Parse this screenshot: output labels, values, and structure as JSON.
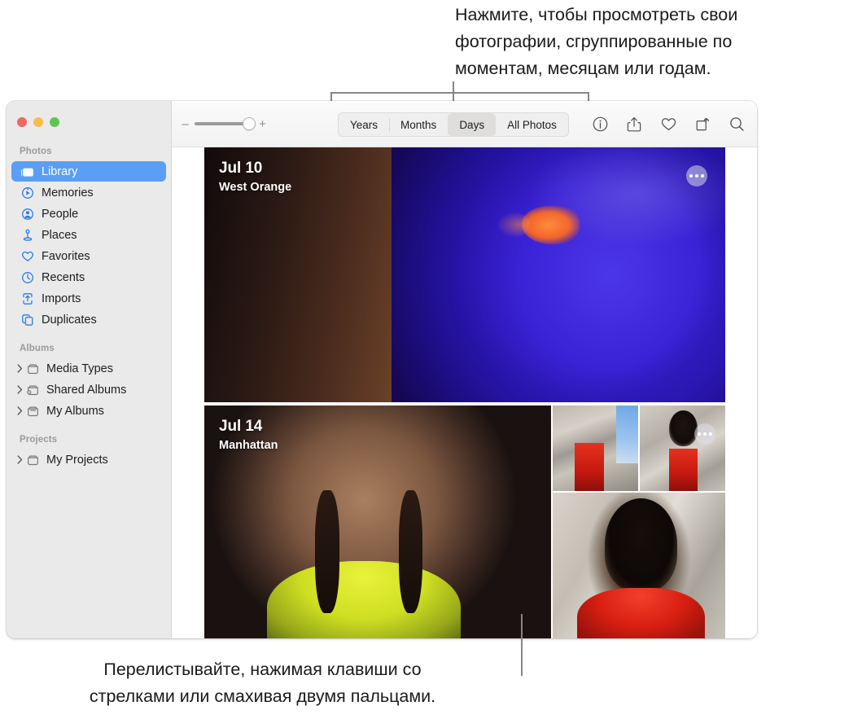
{
  "callouts": {
    "top": "Нажмите, чтобы просмотреть свои\nфотографии, сгруппированные по\nмоментам, месяцам или годам.",
    "bottom": "Перелистывайте, нажимая клавиши со\nстрелками или смахивая двумя пальцами."
  },
  "window": {
    "traffic_lights": [
      "close",
      "minimize",
      "maximize"
    ]
  },
  "sidebar": {
    "sections": [
      {
        "label": "Photos",
        "items": [
          {
            "label": "Library",
            "icon": "photos-library-icon",
            "selected": true
          },
          {
            "label": "Memories",
            "icon": "memories-icon",
            "selected": false
          },
          {
            "label": "People",
            "icon": "people-icon",
            "selected": false
          },
          {
            "label": "Places",
            "icon": "places-pin-icon",
            "selected": false
          },
          {
            "label": "Favorites",
            "icon": "heart-icon",
            "selected": false
          },
          {
            "label": "Recents",
            "icon": "clock-icon",
            "selected": false
          },
          {
            "label": "Imports",
            "icon": "import-icon",
            "selected": false
          },
          {
            "label": "Duplicates",
            "icon": "duplicates-icon",
            "selected": false
          }
        ]
      },
      {
        "label": "Albums",
        "items": [
          {
            "label": "Media Types",
            "icon": "folder-icon",
            "expandable": true
          },
          {
            "label": "Shared Albums",
            "icon": "shared-folder-icon",
            "expandable": true
          },
          {
            "label": "My Albums",
            "icon": "folder-icon",
            "expandable": true
          }
        ]
      },
      {
        "label": "Projects",
        "items": [
          {
            "label": "My Projects",
            "icon": "folder-icon",
            "expandable": true
          }
        ]
      }
    ]
  },
  "toolbar": {
    "zoom_slider": {
      "minus_label": "–",
      "plus_label": "+",
      "value": 92
    },
    "segments": [
      {
        "label": "Years",
        "active": false
      },
      {
        "label": "Months",
        "active": false
      },
      {
        "label": "Days",
        "active": true
      },
      {
        "label": "All Photos",
        "active": false
      }
    ],
    "icons": [
      {
        "name": "info-icon"
      },
      {
        "name": "share-icon"
      },
      {
        "name": "heart-icon"
      },
      {
        "name": "rotate-icon"
      },
      {
        "name": "search-icon"
      }
    ]
  },
  "grid": {
    "groups": [
      {
        "date": "Jul 10",
        "place": "West Orange",
        "more_label": "•••"
      },
      {
        "date": "Jul 14",
        "place": "Manhattan",
        "more_label": "•••"
      }
    ]
  },
  "colors": {
    "selection_blue": "#5a9ef5",
    "sidebar_icon_blue": "#2a7bea",
    "sidebar_bg": "#ebeaea",
    "callout_line": "#868686"
  }
}
